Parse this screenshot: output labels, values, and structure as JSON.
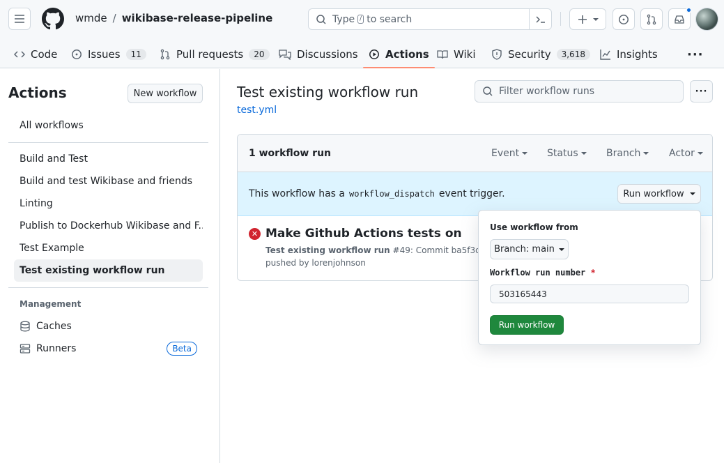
{
  "header": {
    "owner": "wmde",
    "separator": "/",
    "repo": "wikibase-release-pipeline",
    "search_prefix": "Type",
    "search_key": "/",
    "search_suffix": "to search"
  },
  "tabs": [
    {
      "label": "Code",
      "icon": "code-icon"
    },
    {
      "label": "Issues",
      "count": "11",
      "icon": "issue-icon"
    },
    {
      "label": "Pull requests",
      "count": "20",
      "icon": "pull-request-icon"
    },
    {
      "label": "Discussions",
      "icon": "discussion-icon"
    },
    {
      "label": "Actions",
      "icon": "play-icon",
      "active": true
    },
    {
      "label": "Wiki",
      "icon": "book-icon"
    },
    {
      "label": "Security",
      "count": "3,618",
      "icon": "shield-icon"
    },
    {
      "label": "Insights",
      "icon": "graph-icon"
    }
  ],
  "sidebar": {
    "title": "Actions",
    "new_workflow": "New workflow",
    "all_workflows": "All workflows",
    "workflows": [
      "Build and Test",
      "Build and test Wikibase and friends",
      "Linting",
      "Publish to Dockerhub Wikibase and F...",
      "Test Example",
      "Test existing workflow run"
    ],
    "management_title": "Management",
    "caches": "Caches",
    "runners": "Runners",
    "beta": "Beta"
  },
  "main": {
    "title": "Test existing workflow run",
    "file": "test.yml",
    "filter_placeholder": "Filter workflow runs",
    "run_count": "1 workflow run",
    "filters": [
      "Event",
      "Status",
      "Branch",
      "Actor"
    ],
    "banner_prefix": "This workflow has a",
    "banner_code": "workflow_dispatch",
    "banner_suffix": "event trigger.",
    "run_workflow": "Run workflow",
    "run": {
      "title": "Make Github Actions tests on data...",
      "workflow": "Test existing workflow run",
      "detail": "#49: Commit ba5f3d5",
      "pushed_by": "pushed by lorenjohnson"
    }
  },
  "popover": {
    "use_from": "Use workflow from",
    "branch": "Branch: main",
    "run_number_label": "Workflow run number",
    "required": "*",
    "run_number_value": "503165443",
    "submit": "Run workflow"
  },
  "colors": {
    "accent": "#0969da",
    "tab_underline": "#fd8c73",
    "success": "#1f883d",
    "failure": "#d1242f",
    "banner": "#ddf4ff"
  }
}
